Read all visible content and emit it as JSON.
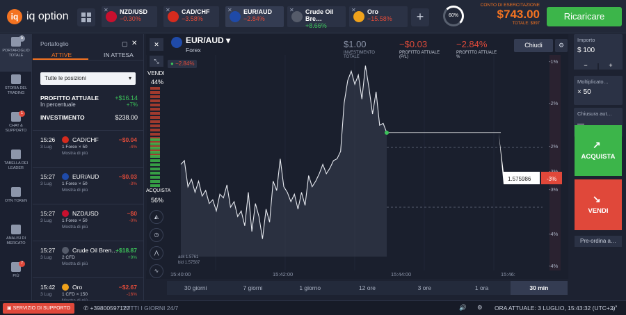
{
  "brand": {
    "name": "iq option",
    "mark": "iq"
  },
  "tabs": [
    {
      "name": "NZD/USD",
      "change": "−0.30%",
      "color": "#c8102e",
      "neg": true
    },
    {
      "name": "CAD/CHF",
      "change": "−3.58%",
      "color": "#d52b1e",
      "neg": true
    },
    {
      "name": "EUR/AUD",
      "change": "−2.84%",
      "color": "#1f4aa8",
      "neg": true,
      "active": true
    },
    {
      "name": "Crude Oil Bre…",
      "change": "+8.66%",
      "color": "#555b6a",
      "neg": false
    },
    {
      "name": "Oro",
      "change": "−15.58%",
      "color": "#f0a21b",
      "neg": true
    }
  ],
  "gauge": "60%",
  "account": {
    "label": "CONTO DI ESERCITAZIONE",
    "balance": "$743.00",
    "total": "TOTALE: $997"
  },
  "recharge": "Ricaricare",
  "sidebar": [
    {
      "label": "PORTAFOGLIO TOTALE",
      "badge": "5"
    },
    {
      "label": "STORIA DEL TRADING"
    },
    {
      "label": "CHAT & SUPPORTO",
      "badge": "1"
    },
    {
      "label": "TABELLA DEI LEADER"
    },
    {
      "label": "OTN TOKEN"
    },
    {
      "label": "ANALISI DI MERCATO"
    },
    {
      "label": "PIÙ",
      "badge": "7"
    }
  ],
  "portfolio": {
    "title": "Portafoglio",
    "tab_active": "ATTIVE",
    "tab_wait": "IN ATTESA",
    "filter": "Tutte le posizioni",
    "profit_label": "PROFITTO ATTUALE",
    "profit_val": "+$16.14",
    "pct_label": "In percentuale",
    "pct_val": "+7%",
    "inv_label": "INVESTIMENTO",
    "inv_val": "$238.00",
    "trades": [
      {
        "time": "15:26",
        "date": "3 Lug",
        "asset": "CAD/CHF",
        "type": "1 Forex × 50",
        "pl": "−$0.04",
        "pct": "-4%",
        "neg": true,
        "color": "#d52b1e"
      },
      {
        "time": "15:27",
        "date": "3 Lug",
        "asset": "EUR/AUD",
        "type": "1 Forex × 50",
        "pl": "−$0.03",
        "pct": "-3%",
        "neg": true,
        "color": "#1f4aa8"
      },
      {
        "time": "15:27",
        "date": "3 Lug",
        "asset": "NZD/USD",
        "type": "1 Forex × 50",
        "pl": "−$0",
        "pct": "-0%",
        "neg": true,
        "color": "#c8102e"
      },
      {
        "time": "15:27",
        "date": "3 Lug",
        "asset": "Crude Oil Bren…",
        "type": "2 CFD",
        "pl": "+$18.87",
        "pct": "+9%",
        "neg": false,
        "color": "#555b6a"
      },
      {
        "time": "15:42",
        "date": "3 Lug",
        "asset": "Oro",
        "type": "1 CFD × 150",
        "pl": "−$2.67",
        "pct": "-16%",
        "neg": true,
        "color": "#f0a21b"
      }
    ],
    "more": "Mostra di più"
  },
  "chart_head": {
    "pair": "EUR/AUD",
    "sub": "Forex",
    "badge": "−2.84%",
    "inv_val": "$1.00",
    "inv_lbl": "INVESTIMENTO TOTALE",
    "pl_val": "−$0.03",
    "pl_lbl": "PROFITTO ATTUALE (P/L)",
    "pct_val": "−2.84%",
    "pct_lbl": "PROFITTO ATTUALE %",
    "close": "Chiudi"
  },
  "sentiment": {
    "sell_label": "VENDI",
    "sell_pct": "44%",
    "buy_label": "ACQUISTA",
    "buy_pct": "56%"
  },
  "chart_data": {
    "type": "line",
    "x_ticks": [
      "15:40:00",
      "15:42:00",
      "15:44:00",
      "15:46:"
    ],
    "y_ticks": [
      "-1%",
      "-2%",
      "-2%",
      "-3%",
      "-3%",
      "-4%",
      "-4%"
    ],
    "last_price": "1.575986",
    "last_pct": "-3%",
    "ask": "ask 1.5761",
    "bid": "bid 1.57587",
    "values": [
      0.45,
      0.47,
      0.33,
      0.37,
      0.3,
      0.36,
      0.28,
      0.31,
      0.24,
      0.26,
      0.2,
      0.29,
      0.27,
      0.34,
      0.22,
      0.25,
      0.17,
      0.2,
      0.12,
      0.3,
      0.09,
      0.24,
      0.17,
      0.05,
      0.21,
      0.14,
      0.36,
      0.31,
      0.48,
      0.33,
      0.3,
      0.25,
      0.29,
      0.21,
      0.3,
      0.23,
      0.39,
      0.33,
      0.36,
      0.4,
      0.45,
      0.4,
      0.43,
      0.47,
      0.48,
      0.52,
      0.78,
      0.9,
      0.95,
      0.88,
      0.93,
      0.8,
      0.98,
      0.86,
      0.72,
      0.84,
      0.66,
      0.67,
      0.62
    ]
  },
  "order": {
    "amount_label": "Importo",
    "amount_val": "$ 100",
    "mult_label": "Moltiplicato…",
    "mult_val": "× 50",
    "autoclose_label": "Chiusura aut…",
    "autoclose_val": "—",
    "buy": "ACQUISTA",
    "sell": "VENDI",
    "preorder": "Pre-ordina a…"
  },
  "periods": [
    "30 giorni",
    "7 giorni",
    "1 giorno",
    "12 ore",
    "3 ore",
    "1 ora",
    "30 min"
  ],
  "footer": {
    "support": "SERVIZIO DI SUPPORTO",
    "phone": "+39800597127",
    "hours": "TUTTI I GIORNI 24/7",
    "time": "ORA ATTUALE: 3 LUGLIO, 15:43:32 (UTC+2)"
  }
}
